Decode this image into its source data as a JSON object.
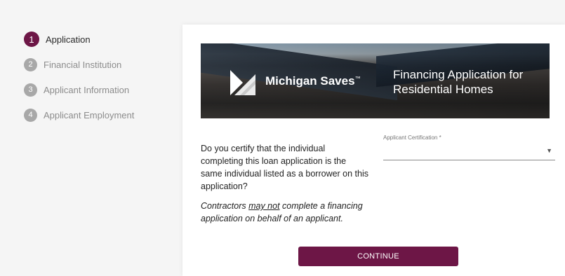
{
  "sidebar": {
    "steps": [
      {
        "number": "1",
        "label": "Application"
      },
      {
        "number": "2",
        "label": "Financial Institution"
      },
      {
        "number": "3",
        "label": "Applicant Information"
      },
      {
        "number": "4",
        "label": "Applicant Employment"
      }
    ],
    "active_step": 1
  },
  "banner": {
    "brand": "Michigan Saves",
    "brand_mark": "™",
    "title": "Financing Application for Residential Homes"
  },
  "form": {
    "question": "Do you certify that the individual completing this loan application is the same individual listed as a borrower on this application?",
    "note_prefix": "Contractors ",
    "note_emphasis": "may not",
    "note_suffix": " complete a financing application on behalf of an applicant.",
    "certification_label": "Applicant Certification *",
    "certification_value": ""
  },
  "actions": {
    "continue_label": "CONTINUE"
  },
  "colors": {
    "accent": "#6d1646",
    "inactive_step": "#a8a8a8"
  }
}
